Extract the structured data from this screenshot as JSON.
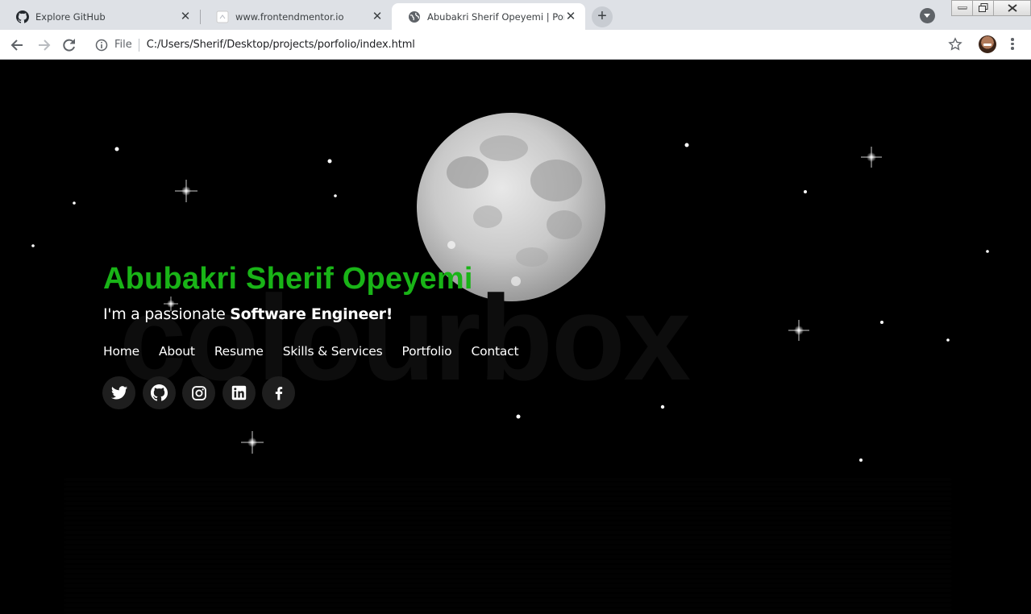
{
  "browser": {
    "tabs": [
      {
        "title": "Explore GitHub",
        "active": false,
        "icon": "github-icon"
      },
      {
        "title": "www.frontendmentor.io",
        "active": false,
        "icon": "page-icon"
      },
      {
        "title": "Abubakri Sherif Opeyemi | Portfolio",
        "active": true,
        "icon": "globe-icon"
      }
    ],
    "address": {
      "scheme_label": "File",
      "url": "C:/Users/Sherif/Desktop/projects/porfolio/index.html"
    }
  },
  "hero": {
    "name": "Abubakri Sherif Opeyemi",
    "tagline_prefix": "I'm a passionate ",
    "tagline_emphasis": "Software Engineer!",
    "watermark": "colourbox",
    "name_color": "#19b417"
  },
  "nav": {
    "items": [
      "Home",
      "About",
      "Resume",
      "Skills & Services",
      "Portfolio",
      "Contact"
    ]
  },
  "socials": [
    {
      "name": "twitter-icon"
    },
    {
      "name": "github-icon"
    },
    {
      "name": "instagram-icon"
    },
    {
      "name": "linkedin-icon"
    },
    {
      "name": "facebook-icon"
    }
  ]
}
